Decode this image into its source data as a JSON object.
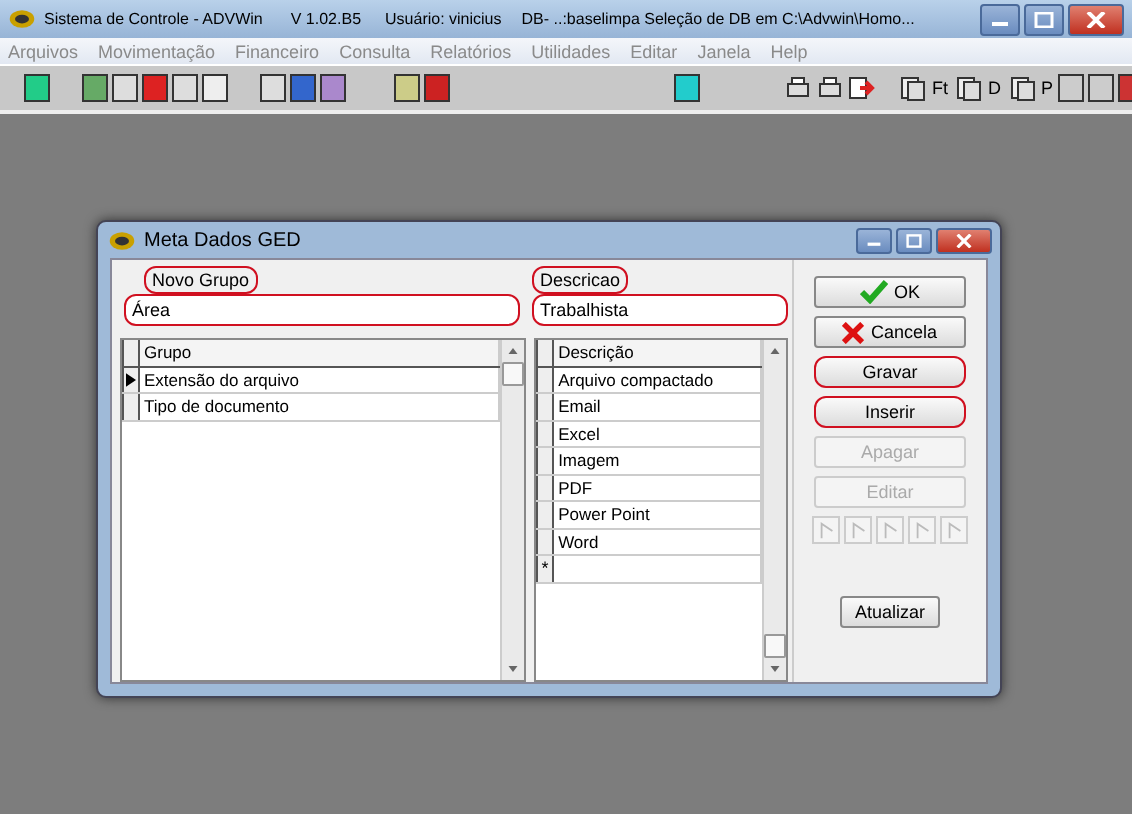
{
  "window": {
    "title": "Sistema de Controle - ADVWin",
    "version": "V 1.02.B5",
    "user": "Usuário: vinicius",
    "db": "DB- ..:baselimpa  Seleção de DB em C:\\Advwin\\Homo..."
  },
  "menu": [
    {
      "label": "Arquivos"
    },
    {
      "label": "Movimentação"
    },
    {
      "label": "Financeiro"
    },
    {
      "label": "Consulta"
    },
    {
      "label": "Relatórios"
    },
    {
      "label": "Utilidades"
    },
    {
      "label": "Editar"
    },
    {
      "label": "Janela"
    },
    {
      "label": "Help"
    }
  ],
  "toolbar": {
    "doc_labels": [
      "Ft",
      "D",
      "P"
    ]
  },
  "dialog": {
    "title": "Meta Dados GED",
    "fields": [
      {
        "label": "Novo Grupo",
        "value": "Área",
        "label_highlighted": true,
        "value_highlighted": true
      },
      {
        "label": "Descricao",
        "value": "Trabalhista",
        "label_highlighted": true,
        "value_highlighted": true
      }
    ],
    "group_grid": {
      "column": "Grupo",
      "rows": [
        {
          "text": "Extensão do arquivo",
          "selected": true
        },
        {
          "text": "Tipo de documento",
          "selected": false
        }
      ]
    },
    "description_grid": {
      "column": "Descrição",
      "rows": [
        {
          "text": "Arquivo compactado"
        },
        {
          "text": "Email"
        },
        {
          "text": "Excel"
        },
        {
          "text": "Imagem"
        },
        {
          "text": "PDF"
        },
        {
          "text": "Power Point"
        },
        {
          "text": "Word"
        }
      ],
      "new_row_marker": "*"
    },
    "buttons": [
      {
        "kind": "ok",
        "label": "OK",
        "disabled": false,
        "highlighted": false
      },
      {
        "kind": "cancel",
        "label": "Cancela",
        "disabled": false,
        "highlighted": false
      },
      {
        "kind": "text",
        "label": "Gravar",
        "disabled": false,
        "highlighted": true
      },
      {
        "kind": "text",
        "label": "Inserir",
        "disabled": false,
        "highlighted": true
      },
      {
        "kind": "text",
        "label": "Apagar",
        "disabled": true,
        "highlighted": false
      },
      {
        "kind": "text",
        "label": "Editar",
        "disabled": true,
        "highlighted": false
      }
    ],
    "nav_buttons": [
      {
        "disabled": true
      },
      {
        "disabled": true
      },
      {
        "disabled": true
      },
      {
        "disabled": true
      },
      {
        "disabled": true
      }
    ],
    "refresh_button": {
      "label": "Atualizar"
    }
  }
}
